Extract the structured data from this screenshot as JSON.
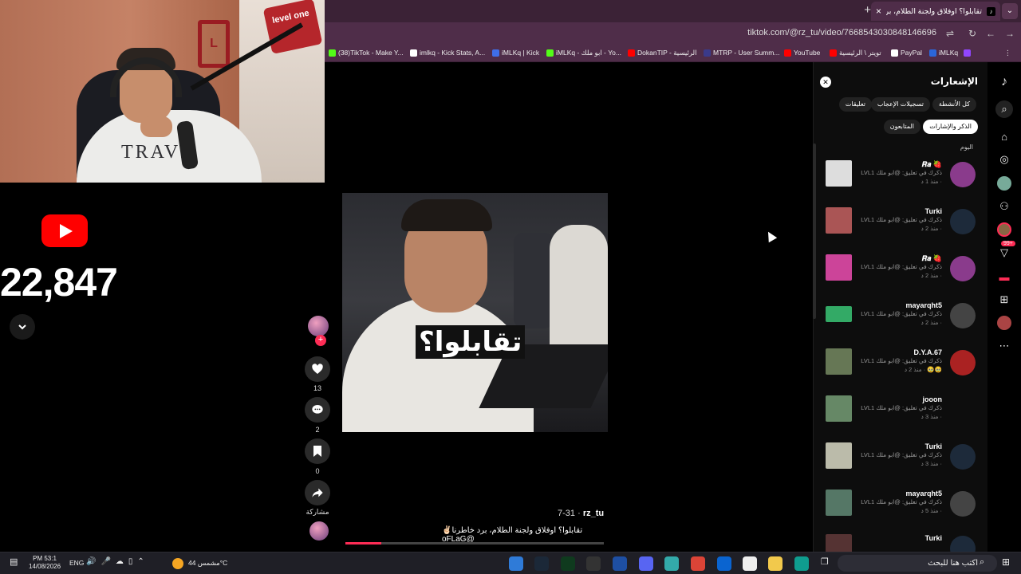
{
  "browser": {
    "tab_title": "تقابلوا؟ اوفلاق ولجنة الطلام، برد",
    "tab_icon": "tiktok-icon",
    "url": "tiktok.com/@rz_tu/video/7668543030848146696"
  },
  "bookmarks": [
    {
      "label": "(38)TikTok - Make Y...",
      "color": "#53fc18"
    },
    {
      "label": "imlkq - Kick Stats, A...",
      "color": "#ffffff"
    },
    {
      "label": "iMLKq | Kick",
      "color": "#3f6ee8"
    },
    {
      "label": "iMLKq - ابو ملك - Yo...",
      "color": "#53fc18"
    },
    {
      "label": "DokanTIP - الرئيسية",
      "color": "#ff0000"
    },
    {
      "label": "MTRP - User Summ...",
      "color": "#3a3a8a"
    },
    {
      "label": "YouTube",
      "color": "#ff0000"
    },
    {
      "label": "تويتر \\ الرئيسية",
      "color": "#ff0000"
    },
    {
      "label": "PayPal",
      "color": "#ffffff"
    },
    {
      "label": "iMLKq",
      "color": "#2b66d9"
    }
  ],
  "webcam": {
    "shirt_text": "TRAVI",
    "sign_text": "level one"
  },
  "stream_overlay": {
    "subscriber_count": "22,847",
    "platform_icon": "youtube-icon"
  },
  "video": {
    "caption_overlay": "تقابلوا؟",
    "author": "rz_tu",
    "date": "7-31",
    "description": "تقابلوا؟ اوفلاق ولجنة الطلام، برد خاطرنا✌🏻 @oFLaG",
    "progress": 0.14,
    "likes": "13",
    "comments": "2",
    "saves": "0",
    "share_label": "مشاركة"
  },
  "notifications": {
    "title": "الإشعارات",
    "tabs": [
      "كل الأنشطة",
      "تسجيلات الإعجاب",
      "تعليقات",
      "الذكر والإشارات",
      "المتابعون"
    ],
    "selected_tab": "الذكر والإشارات",
    "section": "اليوم",
    "items": [
      {
        "name": "𝑹𝒂 🍓",
        "text": "ذكرك في تعليق: @ابو ملك LVL1",
        "time": "· منذ 1 د"
      },
      {
        "name": "Turki",
        "text": "ذكرك في تعليق: @ابو ملك LVL1",
        "time": "· منذ 2 د"
      },
      {
        "name": "𝑹𝒂 🍓",
        "text": "ذكرك في تعليق: @ابو ملك LVL1",
        "time": "· منذ 2 د"
      },
      {
        "name": "mayarqht5",
        "text": "ذكرك في تعليق: @ابو ملك LVL1",
        "time": "· منذ 2 د"
      },
      {
        "name": "D.Y.A.67",
        "text": "ذكرك في تعليق: @ابو ملك LVL1",
        "time": "🥹🥹 · منذ 2 د"
      },
      {
        "name": "jooon",
        "text": "ذكرك في تعليق: @ابو ملك LVL1",
        "time": "· منذ 3 د"
      },
      {
        "name": "Turki",
        "text": "ذكرك في تعليق: @ابو ملك LVL1",
        "time": "· منذ 3 د"
      },
      {
        "name": "mayarqht5",
        "text": "ذكرك في تعليق: @ابو ملك LVL1",
        "time": "· منذ 5 د"
      },
      {
        "name": "Turki",
        "text": "",
        "time": ""
      }
    ]
  },
  "rail": {
    "inbox_badge": "99+"
  },
  "taskbar": {
    "time": "PM 53:1",
    "date": "14/08/2026",
    "lang": "ENG",
    "weather": "مشمس 44°C",
    "search_placeholder": "اكتب هنا للبحث"
  },
  "colors": {
    "accent": "#fe2c55",
    "tab_bg": "#3b2236",
    "toolbar_bg": "#4f2d49"
  }
}
